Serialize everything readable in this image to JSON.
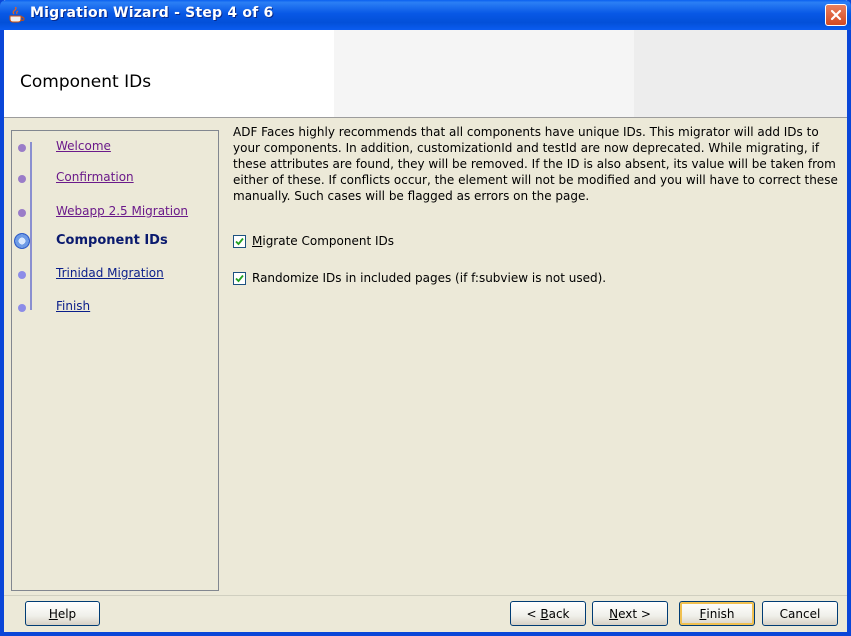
{
  "window": {
    "title": "Migration Wizard - Step 4 of 6"
  },
  "header": {
    "title": "Component IDs"
  },
  "nav": {
    "items": [
      {
        "label": "Welcome",
        "state": "visited"
      },
      {
        "label": "Confirmation",
        "state": "visited"
      },
      {
        "label": "Webapp 2.5 Migration",
        "state": "visited"
      },
      {
        "label": "Component IDs",
        "state": "current"
      },
      {
        "label": "Trinidad Migration",
        "state": "unvisited"
      },
      {
        "label": "Finish",
        "state": "unvisited"
      }
    ]
  },
  "content": {
    "description": "ADF Faces highly recommends that all components have unique IDs. This migrator will add IDs to your components. In addition, customizationId and testId are now deprecated. While migrating, if these attributes are found, they will be removed. If the ID is also absent, its value will be taken from either of these. If conflicts occur, the element will not be modified and you will have to correct these manually. Such cases will be flagged as errors on the page.",
    "options": [
      {
        "label_mnemonic": "M",
        "label_rest": "igrate Component IDs",
        "checked": true
      },
      {
        "label": "Randomize IDs in included pages (if f:subview is not used).",
        "checked": true
      }
    ]
  },
  "buttons": {
    "help": {
      "mnemonic": "H",
      "rest": "elp"
    },
    "back": {
      "prefix": "< ",
      "mnemonic": "B",
      "rest": "ack"
    },
    "next": {
      "mnemonic": "N",
      "rest": "ext >"
    },
    "finish": {
      "mnemonic": "F",
      "rest": "inish"
    },
    "cancel": {
      "label": "Cancel"
    }
  },
  "colors": {
    "titlebar": "#0858e6",
    "close": "#d44a22",
    "nav_current": "#0a1a6e"
  }
}
